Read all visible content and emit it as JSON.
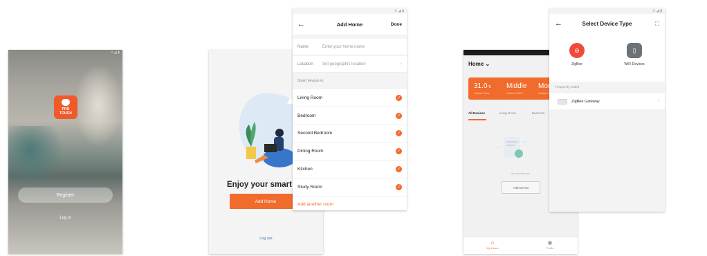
{
  "screen_login": {
    "logo_text_line1": "PRO",
    "logo_text_line2": "TOUCH",
    "register_label": "Register",
    "login_label": "Log in"
  },
  "screen_welcome": {
    "title": "Enjoy your smart l",
    "add_home_label": "Add Home",
    "logout_label": "Log out"
  },
  "screen_add_home": {
    "title": "Add Home",
    "done_label": "Done",
    "name_label": "Name",
    "name_placeholder": "Enter your home name",
    "location_label": "Location",
    "location_placeholder": "Set geographic location",
    "section_label": "Smart devices in:",
    "rooms": [
      "Living Room",
      "Bedroom",
      "Second Bedroom",
      "Dining Room",
      "Kitchen",
      "Study Room"
    ],
    "add_room_label": "Add another room"
  },
  "screen_home": {
    "home_title": "Home",
    "weather": [
      {
        "value": "31.0",
        "unit": "°C",
        "sub": "Outdoor Temp."
      },
      {
        "value": "Middle",
        "sub": "Outdoor PM2.5"
      },
      {
        "value": "Modera",
        "sub": "Outdoor Hum."
      }
    ],
    "tabs": [
      "All Devices",
      "Living Room",
      "Bedroom"
    ],
    "empty_text": "No devices yet",
    "add_device_label": "Add Device",
    "tabbar": [
      "My Home",
      "Profile"
    ]
  },
  "screen_select_device": {
    "title": "Select Device Type",
    "categories": [
      "ZigBee",
      "WiFi Devices"
    ],
    "frequent_label": "Frequently Added",
    "frequent_item": "ZigBee Gateway"
  },
  "colors": {
    "accent": "#f06b2c",
    "zigbee": "#ef4a3c",
    "wifi": "#6c7277"
  }
}
